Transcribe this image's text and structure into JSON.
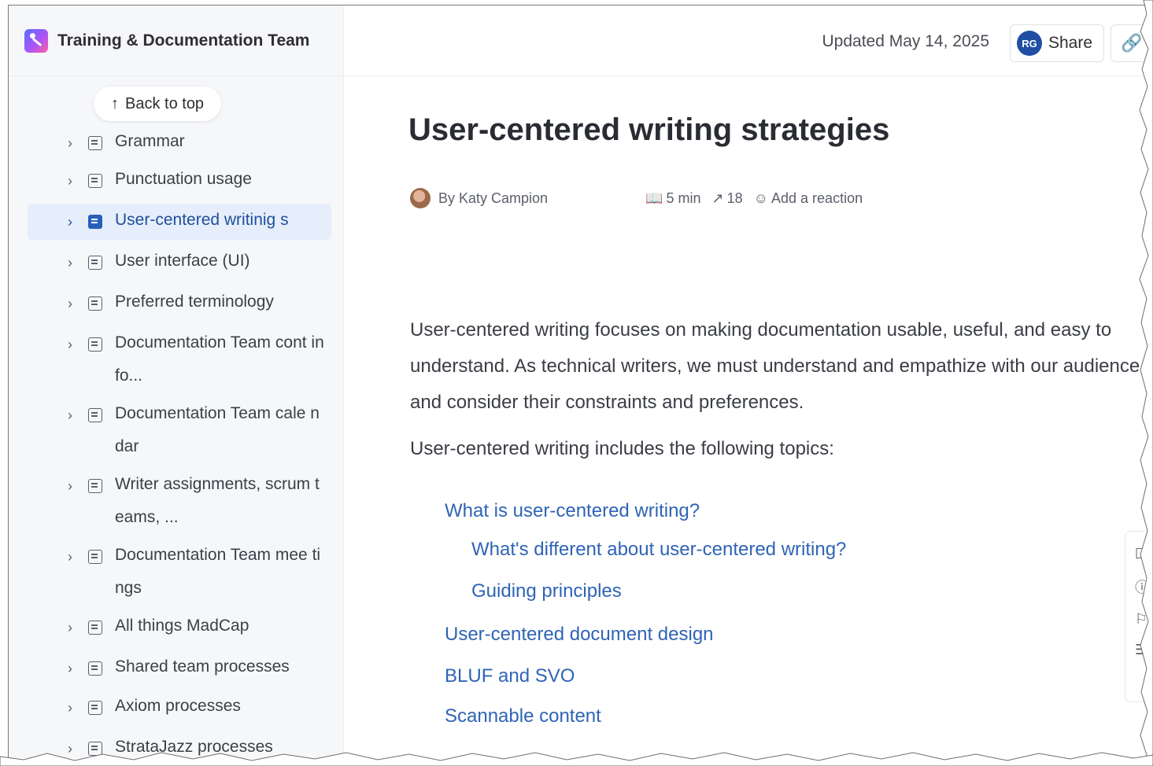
{
  "space": {
    "title": "Training & Documentation Team"
  },
  "header": {
    "updated": "Updated May 14, 2025",
    "avatar_initials": "RG",
    "share_label": "Share",
    "link_icon": "🔗"
  },
  "sidebar": {
    "back_to_top": "Back to top",
    "items": [
      {
        "label": "Grammar",
        "active": false
      },
      {
        "label": "Punctuation usage",
        "active": false
      },
      {
        "label": "User-centered writinig s",
        "active": true
      },
      {
        "label": "User interface (UI)",
        "active": false
      },
      {
        "label": "Preferred terminology",
        "active": false
      },
      {
        "label": "Documentation Team cont info...",
        "active": false
      },
      {
        "label": "Documentation Team cale ndar",
        "active": false
      },
      {
        "label": "Writer assignments, scrum teams, ...",
        "active": false
      },
      {
        "label": "Documentation Team mee tings",
        "active": false
      },
      {
        "label": "All things MadCap",
        "active": false
      },
      {
        "label": "Shared team processes",
        "active": false
      },
      {
        "label": "Axiom processes",
        "active": false
      },
      {
        "label": "StrataJazz processes",
        "active": false
      }
    ]
  },
  "page": {
    "title": "User-centered writing strategies",
    "author": "By Katy Campion",
    "read_time": "5 min",
    "views": "18",
    "reaction": "Add a reaction",
    "paragraph1": "User-centered writing focuses on making documentation usable, useful, and easy to understand. As technical writers, we must understand and empathize with our audience and consider their constraints and preferences.",
    "paragraph2": "User-centered writing includes the following topics:",
    "toc": [
      {
        "text": "What is user-centered writing?",
        "level": 1
      },
      {
        "text": "What's different about user-centered writing?",
        "level": 2
      },
      {
        "text": "Guiding principles",
        "level": 2
      },
      {
        "text": "User-centered document design",
        "level": 1
      },
      {
        "text": "BLUF and SVO",
        "level": 1
      },
      {
        "text": "Scannable content",
        "level": 1
      }
    ]
  },
  "colors": {
    "accent": "#2f64b5",
    "active_bg": "#e6eefb",
    "avatar_rg": "#1f4ea3"
  }
}
